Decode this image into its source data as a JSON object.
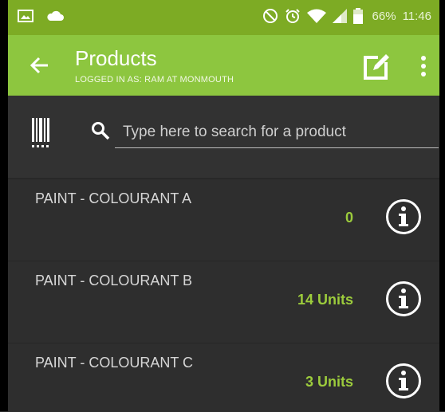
{
  "status_bar": {
    "icons_left": [
      "image-icon",
      "cloud-icon"
    ],
    "icons_right": [
      "do-not-disturb-icon",
      "alarm-icon",
      "wifi-icon",
      "signal-icon",
      "battery-icon"
    ],
    "battery_percent": "66%",
    "time": "11:46"
  },
  "app_bar": {
    "title": "Products",
    "subtitle": "LOGGED IN AS: RAM AT MONMOUTH",
    "actions": [
      "edit-icon",
      "more-vert-icon"
    ]
  },
  "search": {
    "placeholder": "Type here to search for a product",
    "value": ""
  },
  "products": [
    {
      "name": "PAINT - COLOURANT A",
      "quantity": "0"
    },
    {
      "name": "PAINT - COLOURANT B",
      "quantity": "14 Units"
    },
    {
      "name": "PAINT - COLOURANT C",
      "quantity": "3 Units"
    }
  ],
  "colors": {
    "statusbar": "#7dab24",
    "appbar": "#8dc63f",
    "background": "#2a2a2a",
    "quantity_text": "#9ccc3c"
  }
}
